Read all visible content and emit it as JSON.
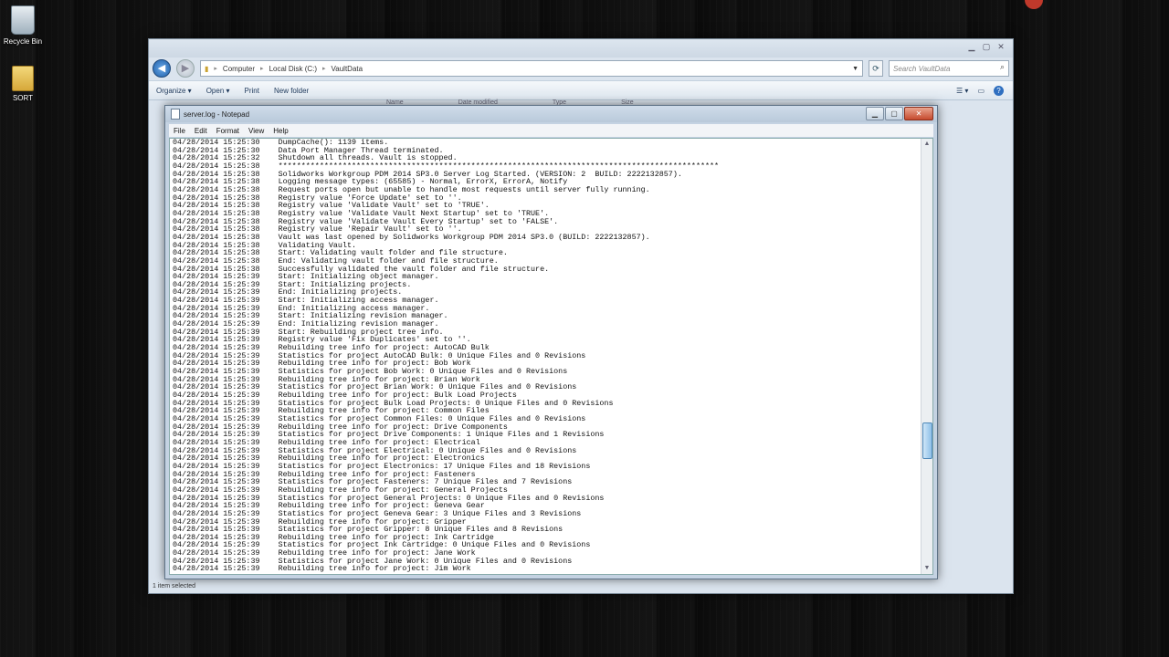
{
  "desktop": {
    "icons": [
      {
        "label": "Recycle Bin"
      },
      {
        "label": "SORT"
      }
    ]
  },
  "explorer": {
    "breadcrumb": [
      "Computer",
      "Local Disk (C:)",
      "VaultData"
    ],
    "search_placeholder": "Search VaultData",
    "commands": {
      "organize": "Organize ▾",
      "open": "Open",
      "print": "Print",
      "new_folder": "New folder"
    },
    "columns": [
      "Name",
      "Date modified",
      "Type",
      "Size"
    ],
    "status": "1 item selected"
  },
  "notepad": {
    "title": "server.log - Notepad",
    "menu": [
      "File",
      "Edit",
      "Format",
      "View",
      "Help"
    ],
    "lines": [
      "04/28/2014 15:25:30    DumpCache(): 1139 items.",
      "04/28/2014 15:25:30    Data Port Manager Thread terminated.",
      "04/28/2014 15:25:32    Shutdown all threads. Vault is stopped.",
      "04/28/2014 15:25:38    ************************************************************************************************",
      "04/28/2014 15:25:38    Solidworks Workgroup PDM 2014 SP3.0 Server Log Started. (VERSION: 2  BUILD: 2222132857).",
      "04/28/2014 15:25:38    Logging message types: (65585) - Normal, ErrorX, ErrorA, Notify",
      "04/28/2014 15:25:38    Request ports open but unable to handle most requests until server fully running.",
      "04/28/2014 15:25:38    Registry value 'Force Update' set to ''.",
      "04/28/2014 15:25:38    Registry value 'Validate Vault' set to 'TRUE'.",
      "04/28/2014 15:25:38    Registry value 'Validate Vault Next Startup' set to 'TRUE'.",
      "04/28/2014 15:25:38    Registry value 'Validate Vault Every Startup' set to 'FALSE'.",
      "04/28/2014 15:25:38    Registry value 'Repair Vault' set to ''.",
      "04/28/2014 15:25:38    Vault was last opened by Solidworks Workgroup PDM 2014 SP3.0 (BUILD: 2222132857).",
      "04/28/2014 15:25:38    Validating Vault.",
      "04/28/2014 15:25:38    Start: Validating vault folder and file structure.",
      "04/28/2014 15:25:38    End: Validating vault folder and file structure.",
      "04/28/2014 15:25:38    Successfully validated the vault folder and file structure.",
      "04/28/2014 15:25:39    Start: Initializing object manager.",
      "04/28/2014 15:25:39    Start: Initializing projects.",
      "04/28/2014 15:25:39    End: Initializing projects.",
      "04/28/2014 15:25:39    Start: Initializing access manager.",
      "04/28/2014 15:25:39    End: Initializing access manager.",
      "04/28/2014 15:25:39    Start: Initializing revision manager.",
      "04/28/2014 15:25:39    End: Initializing revision manager.",
      "04/28/2014 15:25:39    Start: Rebuilding project tree info.",
      "04/28/2014 15:25:39    Registry value 'Fix Duplicates' set to ''.",
      "04/28/2014 15:25:39    Rebuilding tree info for project: AutoCAD Bulk",
      "04/28/2014 15:25:39    Statistics for project AutoCAD Bulk: 0 Unique Files and 0 Revisions",
      "04/28/2014 15:25:39    Rebuilding tree info for project: Bob Work",
      "04/28/2014 15:25:39    Statistics for project Bob Work: 0 Unique Files and 0 Revisions",
      "04/28/2014 15:25:39    Rebuilding tree info for project: Brian Work",
      "04/28/2014 15:25:39    Statistics for project Brian Work: 0 Unique Files and 0 Revisions",
      "04/28/2014 15:25:39    Rebuilding tree info for project: Bulk Load Projects",
      "04/28/2014 15:25:39    Statistics for project Bulk Load Projects: 0 Unique Files and 0 Revisions",
      "04/28/2014 15:25:39    Rebuilding tree info for project: Common Files",
      "04/28/2014 15:25:39    Statistics for project Common Files: 0 Unique Files and 0 Revisions",
      "04/28/2014 15:25:39    Rebuilding tree info for project: Drive Components",
      "04/28/2014 15:25:39    Statistics for project Drive Components: 1 Unique Files and 1 Revisions",
      "04/28/2014 15:25:39    Rebuilding tree info for project: Electrical",
      "04/28/2014 15:25:39    Statistics for project Electrical: 0 Unique Files and 0 Revisions",
      "04/28/2014 15:25:39    Rebuilding tree info for project: Electronics",
      "04/28/2014 15:25:39    Statistics for project Electronics: 17 Unique Files and 18 Revisions",
      "04/28/2014 15:25:39    Rebuilding tree info for project: Fasteners",
      "04/28/2014 15:25:39    Statistics for project Fasteners: 7 Unique Files and 7 Revisions",
      "04/28/2014 15:25:39    Rebuilding tree info for project: General Projects",
      "04/28/2014 15:25:39    Statistics for project General Projects: 0 Unique Files and 0 Revisions",
      "04/28/2014 15:25:39    Rebuilding tree info for project: Geneva Gear",
      "04/28/2014 15:25:39    Statistics for project Geneva Gear: 3 Unique Files and 3 Revisions",
      "04/28/2014 15:25:39    Rebuilding tree info for project: Gripper",
      "04/28/2014 15:25:39    Statistics for project Gripper: 8 Unique Files and 8 Revisions",
      "04/28/2014 15:25:39    Rebuilding tree info for project: Ink Cartridge",
      "04/28/2014 15:25:39    Statistics for project Ink Cartridge: 0 Unique Files and 0 Revisions",
      "04/28/2014 15:25:39    Rebuilding tree info for project: Jane Work",
      "04/28/2014 15:25:39    Statistics for project Jane Work: 0 Unique Files and 0 Revisions",
      "04/28/2014 15:25:39    Rebuilding tree info for project: Jim Work"
    ],
    "scroll_position": 0.72
  }
}
